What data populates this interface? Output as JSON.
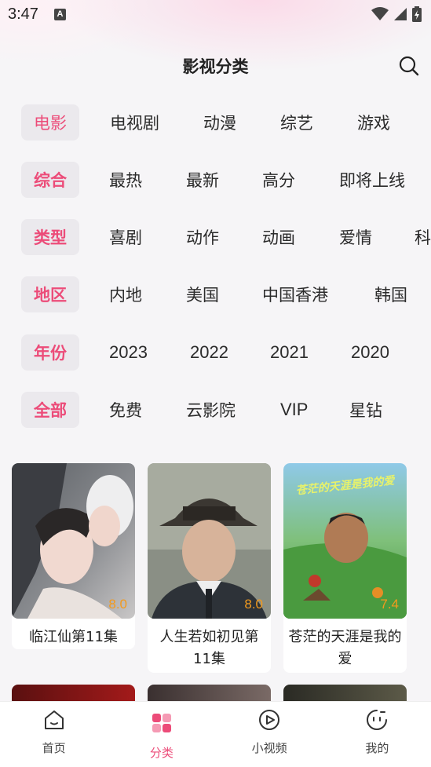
{
  "status": {
    "time": "3:47",
    "notification_glyph": "A"
  },
  "header": {
    "title": "影视分类"
  },
  "filters": [
    {
      "head": "电影",
      "options": [
        "电视剧",
        "动漫",
        "综艺",
        "游戏"
      ]
    },
    {
      "head": "综合",
      "options": [
        "最热",
        "最新",
        "高分",
        "即将上线"
      ]
    },
    {
      "head": "类型",
      "options": [
        "喜剧",
        "动作",
        "动画",
        "爱情",
        "科"
      ]
    },
    {
      "head": "地区",
      "options": [
        "内地",
        "美国",
        "中国香港",
        "韩国"
      ]
    },
    {
      "head": "年份",
      "options": [
        "2023",
        "2022",
        "2021",
        "2020"
      ]
    },
    {
      "head": "全部",
      "options": [
        "免费",
        "云影院",
        "VIP",
        "星钻"
      ]
    }
  ],
  "cards": [
    {
      "title": "临江仙第11集",
      "rating": "8.0",
      "poster_title": ""
    },
    {
      "title": "人生若如初见第11集",
      "rating": "8.0",
      "poster_title": ""
    },
    {
      "title": "苍茫的天涯是我的爱",
      "rating": "7.4",
      "poster_title": "苍茫的天涯是我的爱"
    }
  ],
  "tabbar": [
    {
      "label": "首页",
      "icon": "home-icon",
      "active": false
    },
    {
      "label": "分类",
      "icon": "category-icon",
      "active": true
    },
    {
      "label": "小视频",
      "icon": "play-circle-icon",
      "active": false
    },
    {
      "label": "我的",
      "icon": "profile-face-icon",
      "active": false
    }
  ],
  "colors": {
    "accent": "#ec4c79",
    "rating": "#f39a1d",
    "chip_bg": "#ebe9ed"
  }
}
